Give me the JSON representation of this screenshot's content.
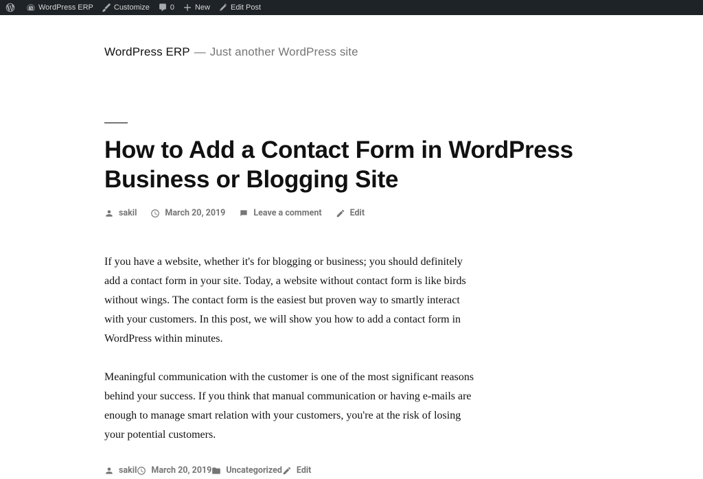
{
  "adminbar": {
    "site_name": "WordPress ERP",
    "customize": "Customize",
    "comments_count": "0",
    "new": "New",
    "edit_post": "Edit Post"
  },
  "header": {
    "title": "WordPress ERP",
    "sep": "—",
    "tagline": "Just another WordPress site"
  },
  "post": {
    "title": "How to Add a Contact Form in WordPress Business or Blogging Site",
    "meta_top": {
      "author": "sakil",
      "date": "March 20, 2019",
      "comment": "Leave a comment",
      "edit": "Edit"
    },
    "paragraphs": [
      "If you have a website, whether it's for blogging or business; you should definitely add a contact form in your site. Today, a website without contact form is like birds without wings. The contact form is the easiest but proven way to smartly interact with your customers. In this post, we will show you how to add a contact form in WordPress within minutes.",
      "Meaningful communication with the customer is one of the most significant reasons behind your success. If you think that manual communication or having e-mails are enough to manage smart relation with your customers, you're at the risk of losing your potential customers."
    ],
    "meta_bottom": {
      "author": "sakil",
      "date": "March 20, 2019",
      "category": "Uncategorized",
      "edit": "Edit"
    }
  }
}
